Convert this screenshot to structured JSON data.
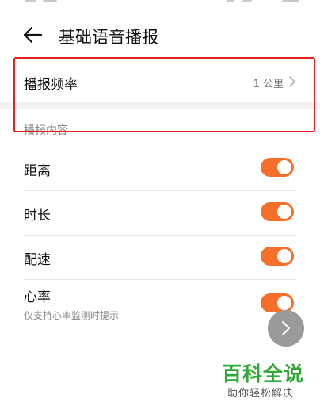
{
  "header": {
    "title": "基础语音播报",
    "back_icon": "arrow-left-icon"
  },
  "frequency": {
    "label": "播报频率",
    "value": "1 公里",
    "icon": "chevron-right-icon"
  },
  "section": {
    "title": "播报内容"
  },
  "toggles": [
    {
      "label": "距离",
      "on": true
    },
    {
      "label": "时长",
      "on": true
    },
    {
      "label": "配速",
      "on": true
    },
    {
      "label": "心率",
      "sublabel": "仅支持心率监测时提示",
      "on": true
    }
  ],
  "fab": {
    "icon": "chevron-right-icon"
  },
  "watermark": {
    "title": "百科全说",
    "subtitle": "助你轻松解决"
  },
  "colors": {
    "accent": "#f4702a",
    "highlight": "#e62020",
    "watermark": "#2fa834"
  }
}
